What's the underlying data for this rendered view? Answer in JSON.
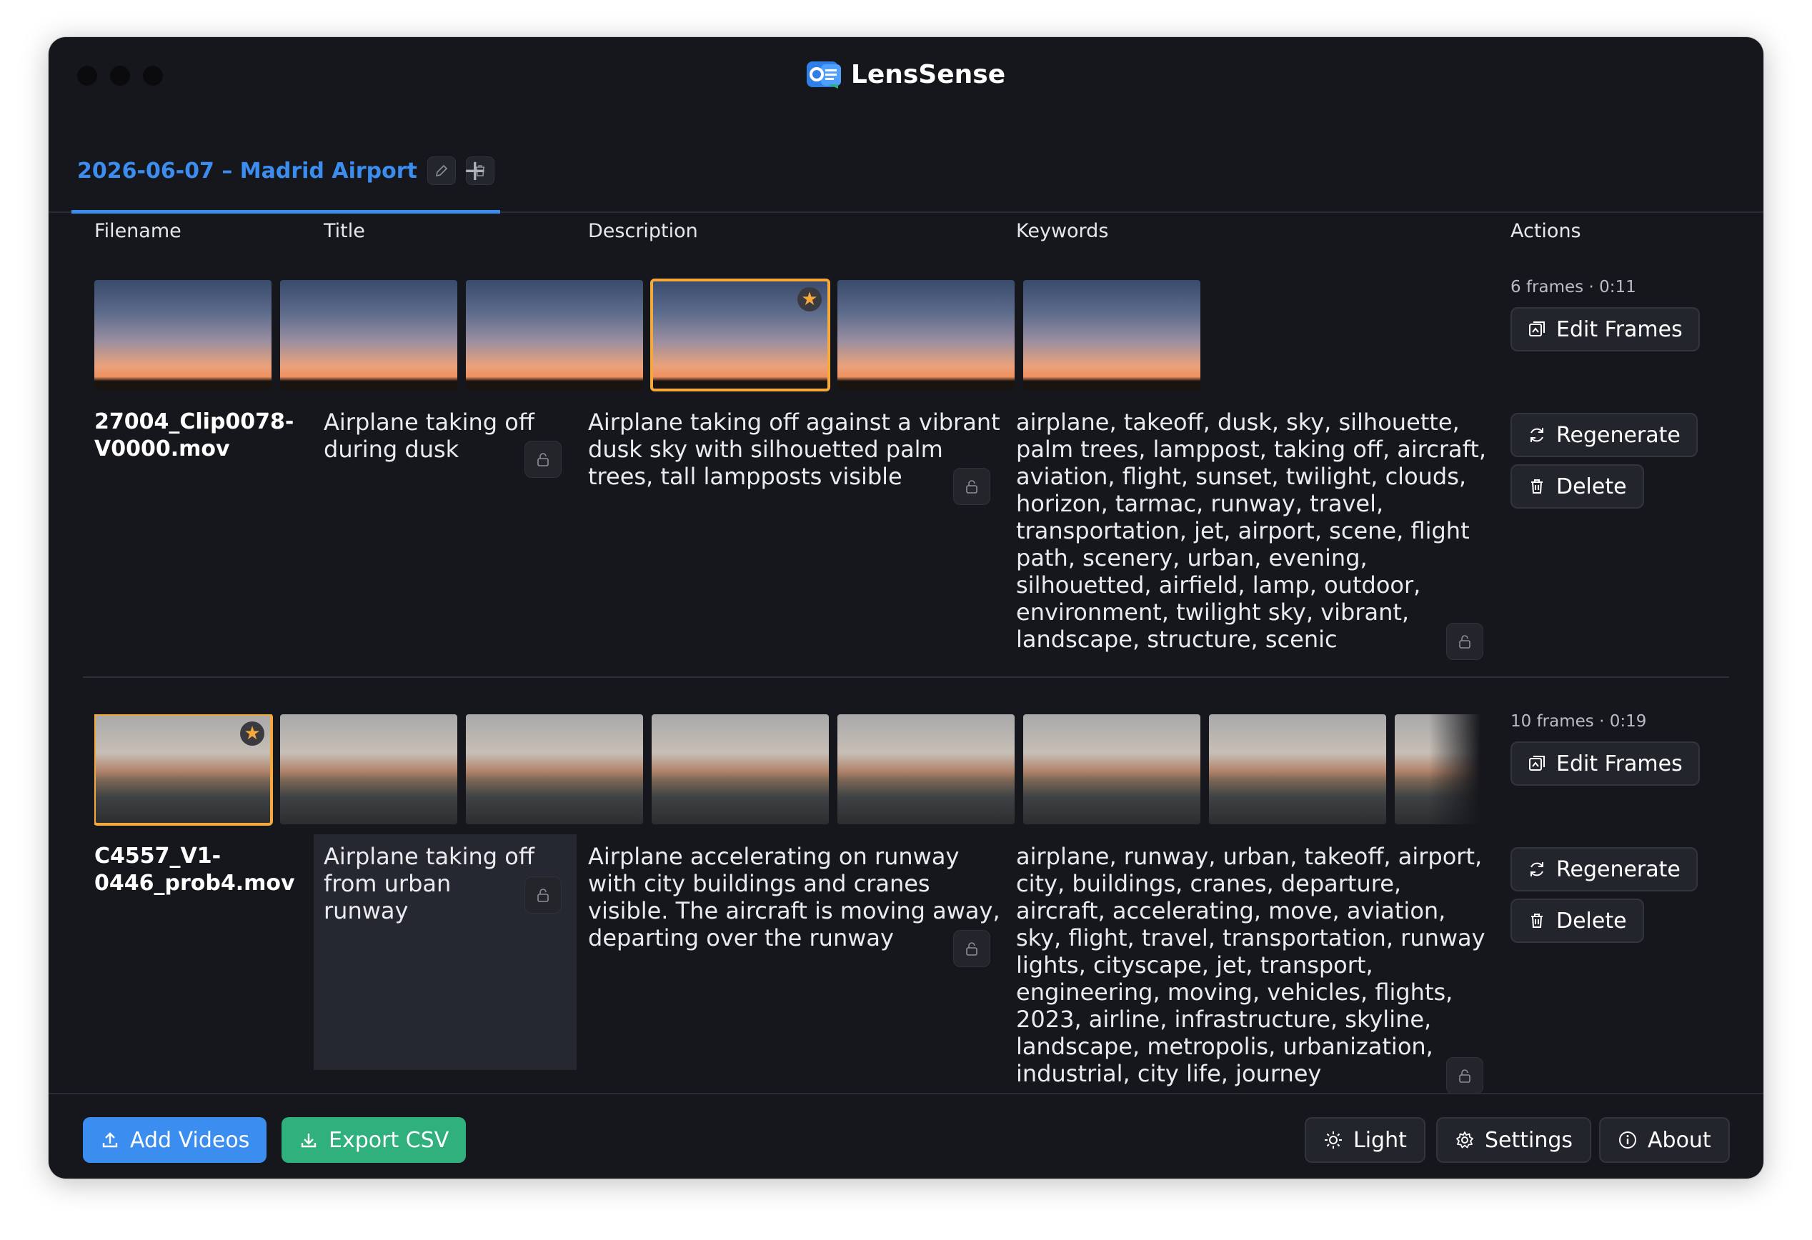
{
  "app": {
    "title": "LensSense"
  },
  "tab": {
    "label": "2026-06-07 – Madrid Airport",
    "add_label": "+"
  },
  "columns": {
    "filename": "Filename",
    "title": "Title",
    "description": "Description",
    "keywords": "Keywords",
    "actions": "Actions"
  },
  "rows": [
    {
      "filename": "27004_Clip0078-V0000.mov",
      "title": "Airplane taking off during dusk",
      "description": "Airplane taking off against a vibrant dusk sky with silhouetted palm trees, tall lampposts visible",
      "keywords": "airplane, takeoff, dusk, sky, silhouette, palm trees, lamppost, taking off, aircraft, aviation, flight, sunset, twilight, clouds, horizon, tarmac, runway, travel, transportation, jet, airport, scene, flight path, scenery, urban, evening, silhouetted, airfield, lamp, outdoor, environment, twilight sky, vibrant, landscape, structure, scenic",
      "meta": "6 frames · 0:11",
      "edit_frames": "Edit Frames",
      "regenerate": "Regenerate",
      "delete": "Delete"
    },
    {
      "filename": "C4557_V1-0446_prob4.mov",
      "title": "Airplane taking off from urban runway",
      "description": "Airplane accelerating on runway with city buildings and cranes visible. The aircraft is moving away, departing over the runway",
      "keywords": "airplane, runway, urban, takeoff, airport, city, buildings, cranes, departure, aircraft, accelerating, move, aviation, sky, flight, travel, transportation, runway lights, cityscape, jet, transport, engineering, moving, vehicles, flights, 2023, airline, infrastructure, skyline, landscape, metropolis, urbanization, industrial, city life, journey",
      "meta": "10 frames · 0:19",
      "edit_frames": "Edit Frames",
      "regenerate": "Regenerate",
      "delete": "Delete"
    }
  ],
  "footer": {
    "add_videos": "Add Videos",
    "export_csv": "Export CSV",
    "light": "Light",
    "settings": "Settings",
    "about": "About"
  },
  "colors": {
    "accent": "#3b8ef0",
    "export": "#2fb07c",
    "selected_frame": "#f4a93a",
    "background": "#16171c"
  }
}
